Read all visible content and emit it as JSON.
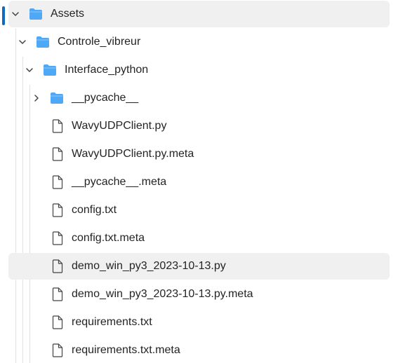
{
  "tree": {
    "accent_color": "#0f6cbd",
    "folder_color": "#4fa8f5",
    "items": [
      {
        "label": "Assets",
        "type": "folder",
        "expanded": true,
        "selected": true
      },
      {
        "label": "Controle_vibreur",
        "type": "folder",
        "expanded": true
      },
      {
        "label": "Interface_python",
        "type": "folder",
        "expanded": true
      },
      {
        "label": "__pycache__",
        "type": "folder",
        "expanded": false
      },
      {
        "label": "WavyUDPClient.py",
        "type": "file"
      },
      {
        "label": "WavyUDPClient.py.meta",
        "type": "file"
      },
      {
        "label": "__pycache__.meta",
        "type": "file"
      },
      {
        "label": "config.txt",
        "type": "file"
      },
      {
        "label": "config.txt.meta",
        "type": "file"
      },
      {
        "label": "demo_win_py3_2023-10-13.py",
        "type": "file",
        "hovered": true
      },
      {
        "label": "demo_win_py3_2023-10-13.py.meta",
        "type": "file"
      },
      {
        "label": "requirements.txt",
        "type": "file"
      },
      {
        "label": "requirements.txt.meta",
        "type": "file"
      }
    ]
  }
}
